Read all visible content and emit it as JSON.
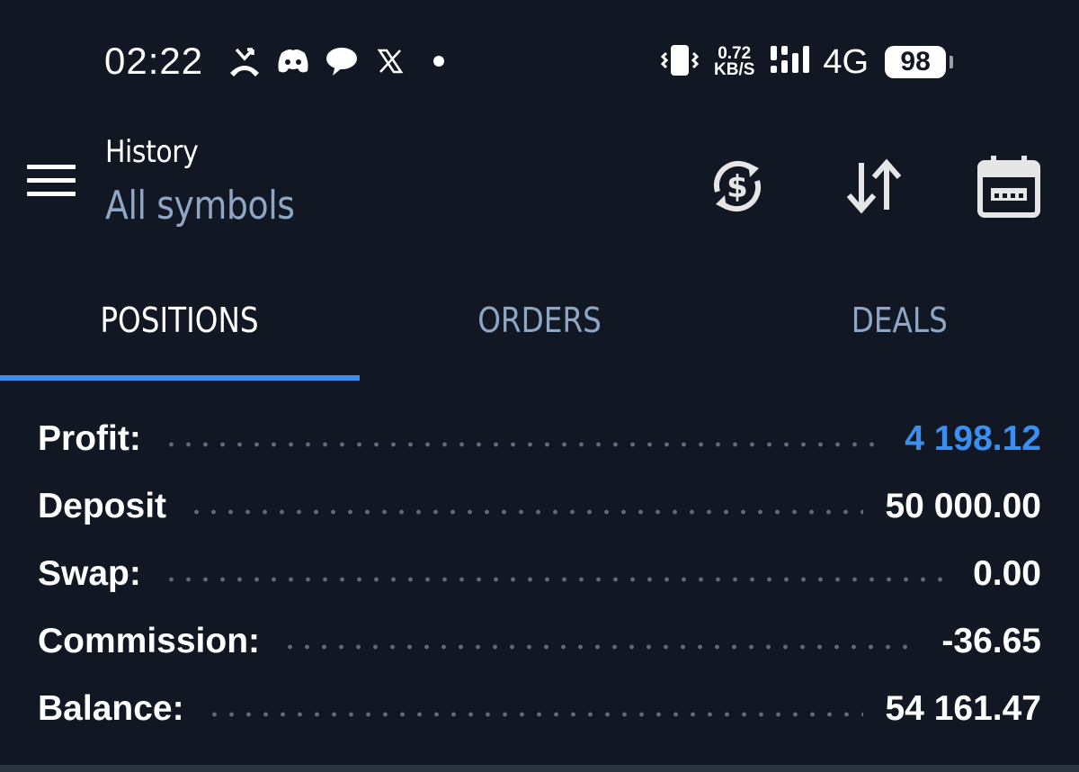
{
  "status_bar": {
    "time": "02:22",
    "notification_icons": [
      "missed-call-icon",
      "discord-icon",
      "chat-bubble-icon",
      "x-icon",
      "dot-icon"
    ],
    "speed_value": "0.72",
    "speed_unit": "KB/S",
    "network": "4G",
    "battery": "98"
  },
  "toolbar": {
    "title": "History",
    "subtitle": "All symbols",
    "icons": [
      "currency-refresh-icon",
      "sort-icon",
      "calendar-icon"
    ]
  },
  "tabs": [
    {
      "label": "POSITIONS",
      "active": true
    },
    {
      "label": "ORDERS",
      "active": false
    },
    {
      "label": "DEALS",
      "active": false
    }
  ],
  "summary": [
    {
      "label": "Profit:",
      "value": "4 198.12",
      "highlight": true
    },
    {
      "label": "Deposit",
      "value": "50 000.00",
      "highlight": false
    },
    {
      "label": "Swap:",
      "value": "0.00",
      "highlight": false
    },
    {
      "label": "Commission:",
      "value": "-36.65",
      "highlight": false
    },
    {
      "label": "Balance:",
      "value": "54 161.47",
      "highlight": false
    }
  ],
  "colors": {
    "background": "#111823",
    "accent": "#3a8ff0",
    "muted": "#8fa7c4"
  }
}
